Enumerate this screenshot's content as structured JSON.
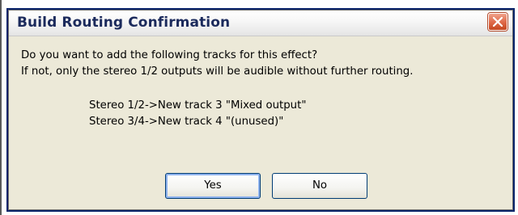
{
  "dialog": {
    "title": "Build Routing Confirmation",
    "message_line1": "Do you want to add the following tracks for this effect?",
    "message_line2": "If not, only the stereo 1/2 outputs will be audible without further routing.",
    "tracks": [
      "Stereo 1/2->New track 3 \"Mixed output\"",
      "Stereo 3/4->New track 4 \"(unused)\""
    ],
    "buttons": {
      "yes_label": "Yes",
      "no_label": "No"
    },
    "close_icon": "close-icon"
  },
  "colors": {
    "frame_border": "#0a246a",
    "dialog_bg": "#ece9d8",
    "close_red": "#e06c4c",
    "title_text": "#1b2a5c"
  }
}
